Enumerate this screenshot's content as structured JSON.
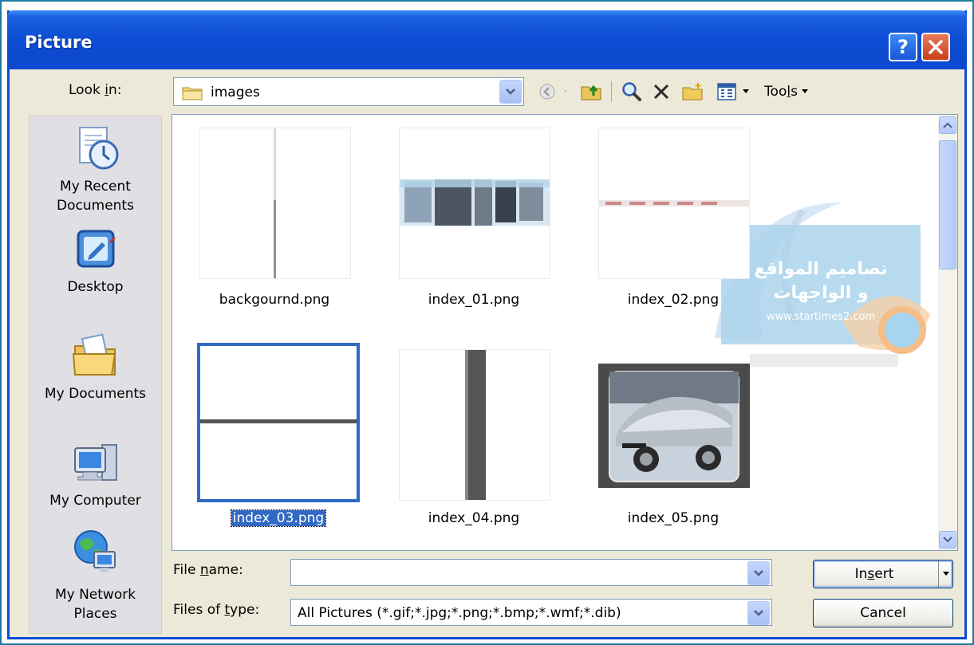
{
  "window": {
    "title": "Picture"
  },
  "look_in": {
    "label_pre": "Look ",
    "label_key": "i",
    "label_post": "n:",
    "value": "images"
  },
  "toolbar": {
    "tools_pre": "Too",
    "tools_key": "l",
    "tools_post": "s"
  },
  "places": [
    {
      "label_line1": "My Recent",
      "label_line2": "Documents",
      "icon": "recent-documents-icon"
    },
    {
      "label_line1": "Desktop",
      "label_line2": "",
      "icon": "desktop-icon"
    },
    {
      "label_line1": "My Documents",
      "label_line2": "",
      "icon": "my-documents-icon"
    },
    {
      "label_line1": "My Computer",
      "label_line2": "",
      "icon": "my-computer-icon"
    },
    {
      "label_line1": "My Network",
      "label_line2": "Places",
      "icon": "network-places-icon"
    }
  ],
  "files": [
    {
      "name": "backgournd.png",
      "selected": false
    },
    {
      "name": "index_01.png",
      "selected": false
    },
    {
      "name": "index_02.png",
      "selected": false
    },
    {
      "name": "index_03.png",
      "selected": true
    },
    {
      "name": "index_04.png",
      "selected": false
    },
    {
      "name": "index_05.png",
      "selected": false
    }
  ],
  "watermark": {
    "line1": "تصاميم المواقع",
    "line2": "و الواجهات",
    "url": "www.startimes2.com"
  },
  "file_name": {
    "label_pre": "File ",
    "label_key": "n",
    "label_post": "ame:",
    "value": ""
  },
  "file_type": {
    "label_pre": "Files of ",
    "label_key": "t",
    "label_post": "ype:",
    "value": "All Pictures (*.gif;*.jpg;*.png;*.bmp;*.wmf;*.dib)"
  },
  "buttons": {
    "insert_pre": "In",
    "insert_key": "s",
    "insert_post": "ert",
    "cancel": "Cancel"
  },
  "colors": {
    "title_bar": "#0b48cc",
    "selection": "#316ac5",
    "dialog_bg": "#ece9d8"
  }
}
